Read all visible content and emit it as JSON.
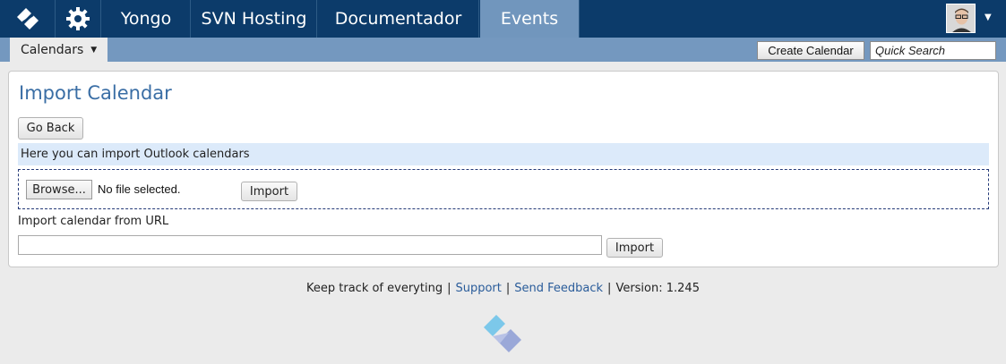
{
  "topbar": {
    "tabs": [
      {
        "label": "Yongo"
      },
      {
        "label": "SVN Hosting"
      },
      {
        "label": "Documentador"
      },
      {
        "label": "Events"
      }
    ]
  },
  "subbar": {
    "calendars_label": "Calendars",
    "create_calendar_label": "Create Calendar",
    "quick_search_placeholder": "Quick Search"
  },
  "main": {
    "title": "Import Calendar",
    "go_back_label": "Go Back",
    "info_text": "Here you can import Outlook calendars",
    "browse_label": "Browse...",
    "no_file_text": "No file selected.",
    "import_label": "Import",
    "url_label": "Import calendar from URL",
    "url_value": "",
    "import_url_label": "Import"
  },
  "footer": {
    "tagline": "Keep track of everyting",
    "support_label": "Support",
    "feedback_label": "Send Feedback",
    "version_text": "Version: 1.245"
  },
  "colors": {
    "topbar": "#0c3b6a",
    "active_tab": "#7196bd",
    "subbar": "#7498bf",
    "title": "#3a6ea5",
    "info_bg": "#dceafa"
  }
}
